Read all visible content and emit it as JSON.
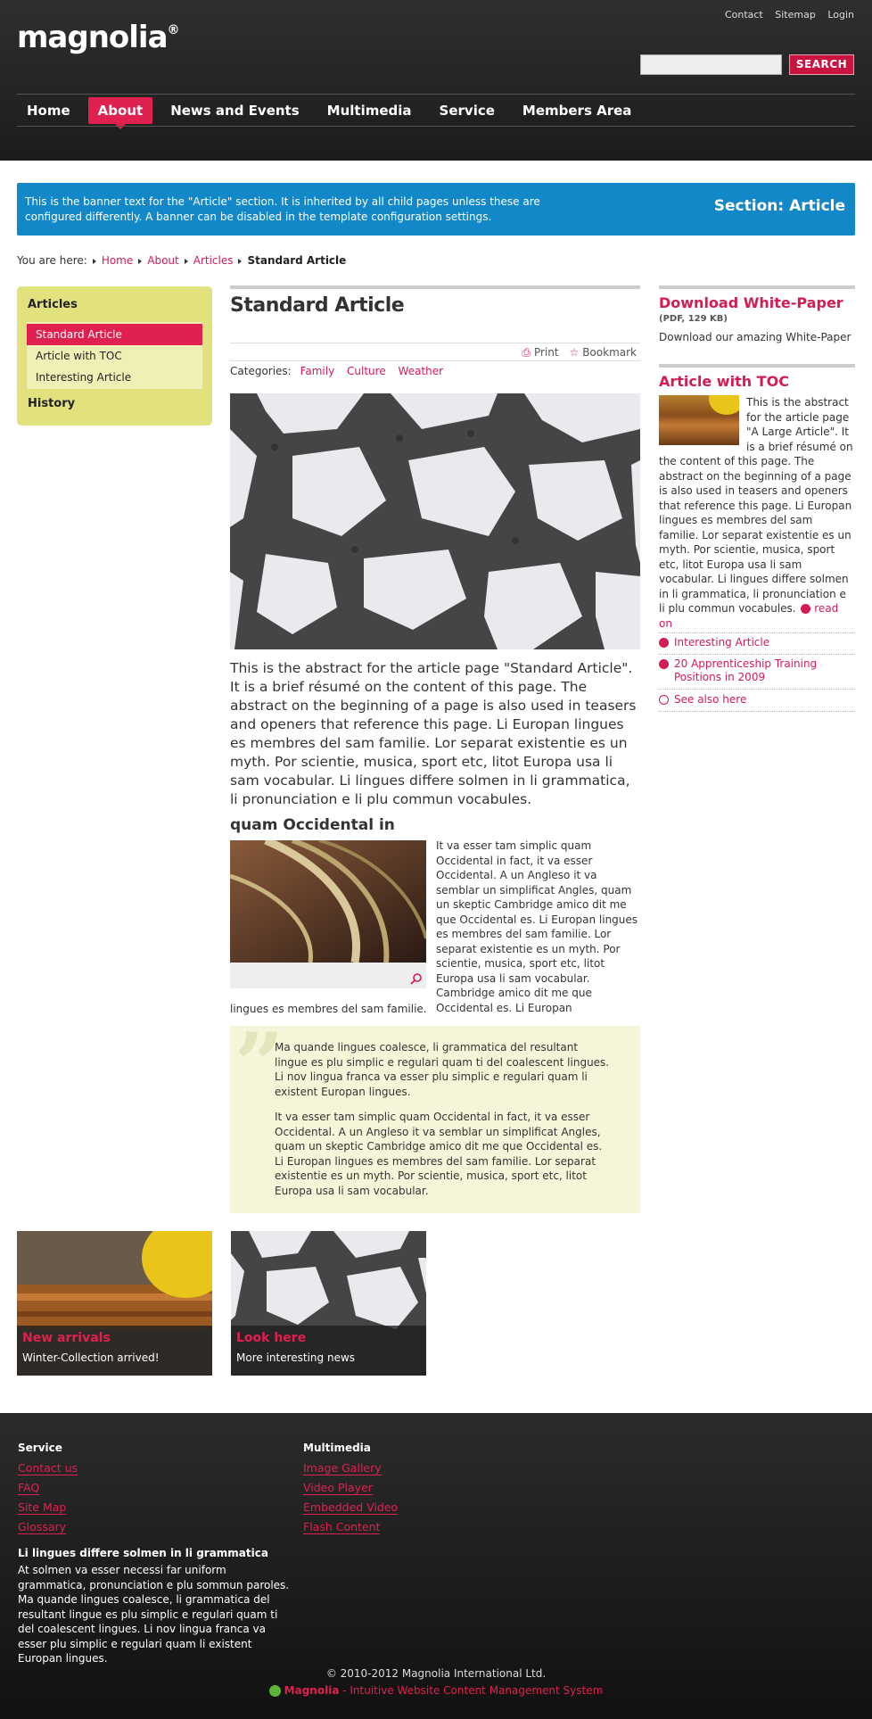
{
  "header": {
    "logo": "magnolia",
    "logo_mark": "®",
    "util_links": [
      "Contact",
      "Sitemap",
      "Login"
    ],
    "search_placeholder": "",
    "search_button": "SEARCH",
    "nav": [
      "Home",
      "About",
      "News and Events",
      "Multimedia",
      "Service",
      "Members Area"
    ],
    "nav_active": "About"
  },
  "banner": {
    "text": "This is the banner text for the \"Article\" section. It is inherited by all child pages unless these are configured differently. A banner can be disabled in the template configuration settings.",
    "title": "Section: Article"
  },
  "breadcrumb": {
    "label": "You are here:",
    "items": [
      "Home",
      "About",
      "Articles"
    ],
    "current": "Standard Article"
  },
  "leftnav": {
    "section1": "Articles",
    "items": [
      "Standard Article",
      "Article with TOC",
      "Interesting Article"
    ],
    "active": "Standard Article",
    "section2": "History"
  },
  "main": {
    "title": "Standard Article",
    "tools": {
      "print": "Print",
      "bookmark": "Bookmark"
    },
    "categories_label": "Categories:",
    "categories": [
      "Family",
      "Culture",
      "Weather"
    ],
    "abstract": "This is the abstract for the article page \"Standard Article\". It is a brief résumé on the content of this page. The abstract on the beginning of a page is also used in teasers and openers that reference this page. Li Europan lingues es membres del sam familie. Lor separat existentie es un myth. Por scientie, musica, sport etc, litot Europa usa li sam vocabular. Li lingues differe solmen in li grammatica, li pronunciation e li plu commun vocabules.",
    "subheading": "quam Occidental in",
    "body_text": "It va esser tam simplic quam Occidental in fact, it va esser Occidental. A un Angleso it va semblar un simplificat Angles, quam un skeptic Cambridge amico dit me que Occidental es. Li Europan lingues es membres del sam familie. Lor separat existentie es un myth. Por scientie, musica, sport etc, litot Europa usa li sam vocabular. Cambridge amico dit me que Occidental es. Li Europan",
    "body_text_tail": "lingues es membres del sam familie.",
    "quote_p1": "Ma quande lingues coalesce, li grammatica del resultant lingue es plu simplic e regulari quam ti del coalescent lingues. Li nov lingua franca va esser plu simplic e regulari quam li existent Europan lingues.",
    "quote_p2": "It va esser tam simplic quam Occidental in fact, it va esser Occidental. A un Angleso it va semblar un simplificat Angles, quam un skeptic Cambridge amico dit me que Occidental es. Li Europan lingues es membres del sam familie. Lor separat existentie es un myth. Por scientie, musica, sport etc, litot Europa usa li sam vocabular."
  },
  "right": {
    "whitepaper_title": "Download White-Paper",
    "whitepaper_meta": "(PDF, 129 KB)",
    "whitepaper_desc": "Download our amazing White-Paper",
    "toc_title": "Article with TOC",
    "toc_text": "This is the abstract for the article page \"A Large Article\". It is a brief résumé on the content of this page. The abstract on the beginning of a page is also used in teasers and openers that reference this page. Li Europan lingues es membres del sam familie. Lor separat existentie es un myth. Por scientie, musica, sport etc, litot Europa usa li sam vocabular. Li lingues differe solmen in li grammatica, li pronunciation e li plu commun vocabules.",
    "read_on": "read on",
    "links": [
      "Interesting Article",
      "20 Apprenticeship Training Positions in 2009"
    ],
    "see_also": "See also here"
  },
  "teasers": [
    {
      "title": "New arrivals",
      "text": "Winter-Collection arrived!"
    },
    {
      "title": "Look here",
      "text": "More interesting news"
    }
  ],
  "footer": {
    "col1_head": "Service",
    "col1_links": [
      "Contact us",
      "FAQ",
      "Site Map",
      "Glossary"
    ],
    "col2_head": "Multimedia",
    "col2_links": [
      "Image Gallery",
      "Video Player",
      "Embedded Video",
      "Flash Content"
    ],
    "about_head": "Li lingues differe solmen in li grammatica",
    "about_text": "At solmen va esser necessi far uniform grammatica, pronunciation e plu sommun paroles. Ma quande lingues coalesce, li grammatica del resultant lingue es plu simplic e regulari quam ti del coalescent lingues. Li nov lingua franca va esser plu simplic e regulari quam li existent Europan lingues.",
    "copyright": "© 2010-2012 Magnolia International Ltd.",
    "tagline_brand": "Magnolia",
    "tagline_rest": " - Intuitive Website Content Management System"
  },
  "colors": {
    "accent": "#e0204f",
    "banner": "#1288c8",
    "leftnav": "#e1e27e",
    "quote_bg": "#f5f6d9"
  }
}
